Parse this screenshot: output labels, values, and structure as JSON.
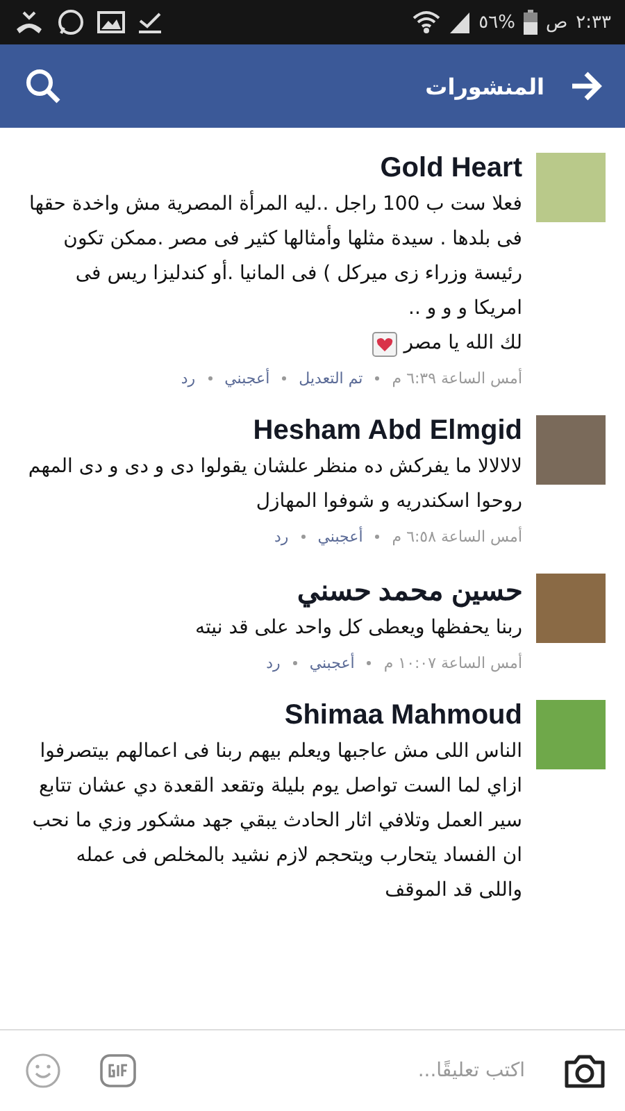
{
  "status_bar": {
    "time": "٢:٣٣",
    "am_pm": "ص",
    "battery": "٥٦%"
  },
  "header": {
    "title": "المنشورات"
  },
  "comments": [
    {
      "name": "Gold Heart",
      "paragraphs": [
        "فعلا ست ب 100 راجل ..ليه المرأة المصرية مش واخدة حقها فى بلدها . سيدة مثلها وأمثالها كثير فى مصر .ممكن تكون رئيسة وزراء  زى ميركل ) فى المانيا .أو  كندليزا ريس فى امريكا و و و  ..",
        "لك الله يا مصر"
      ],
      "heart_emoji": true,
      "time": "أمس الساعة ٦:٣٩ م",
      "edited": "تم التعديل",
      "like": "أعجبني",
      "reply": "رد"
    },
    {
      "name": "Hesham Abd Elmgid",
      "paragraphs": [
        "لالالالا ما يفركش ده منظر علشان يقولوا دى و دى و دى المهم روحوا اسكندريه و شوفوا المهازل"
      ],
      "heart_emoji": false,
      "time": "أمس الساعة ٦:٥٨ م",
      "like": "أعجبني",
      "reply": "رد"
    },
    {
      "name": "حسين محمد حسني",
      "paragraphs": [
        "ربنا يحفظها  ويعطى كل واحد على قد نيته"
      ],
      "heart_emoji": false,
      "time": "أمس الساعة ١٠:٠٧ م",
      "like": "أعجبني",
      "reply": "رد"
    },
    {
      "name": "Shimaa Mahmoud",
      "paragraphs": [
        "الناس اللى مش عاجبها ويعلم بيهم ربنا فى اعمالهم بيتصرفوا ازاي لما الست تواصل يوم بليلة وتقعد القعدة دي عشان تتابع سير العمل وتلافي اثار الحادث يبقي جهد مشكور وزي ما نحب ان الفساد يتحارب ويتحجم لازم نشيد بالمخلص فى عمله واللى قد الموقف"
      ],
      "heart_emoji": false
    }
  ],
  "composer": {
    "placeholder": "اكتب تعليقًا..."
  }
}
